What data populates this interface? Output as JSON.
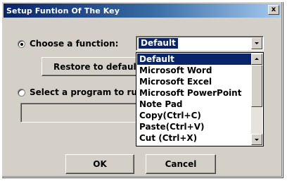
{
  "window": {
    "title": "Setup Funtion Of The Key",
    "close_glyph": "x"
  },
  "choose_function": {
    "label": "Choose a function:",
    "selected": true,
    "combo_value": "Default",
    "options": [
      "Default",
      "Microsoft Word",
      "Microsoft Excel",
      "Microsoft PowerPoint",
      "Note Pad",
      "Copy(Ctrl+C)",
      "Paste(Ctrl+V)",
      "Cut (Ctrl+X)"
    ],
    "highlighted_index": 0
  },
  "restore_button": {
    "label": "Restore to default"
  },
  "select_program": {
    "label": "Select a program to run",
    "selected": false,
    "path_value": ""
  },
  "buttons": {
    "ok": "OK",
    "cancel": "Cancel"
  },
  "icons": {
    "close": "close-icon",
    "combo_arrow": "chevron-down-icon",
    "scroll_up": "arrow-up-icon",
    "scroll_down": "arrow-down-icon"
  },
  "colors": {
    "title_gradient_start": "#0a246a",
    "title_gradient_end": "#a6caf0",
    "selection": "#0a246a",
    "face": "#d4d0c8"
  }
}
